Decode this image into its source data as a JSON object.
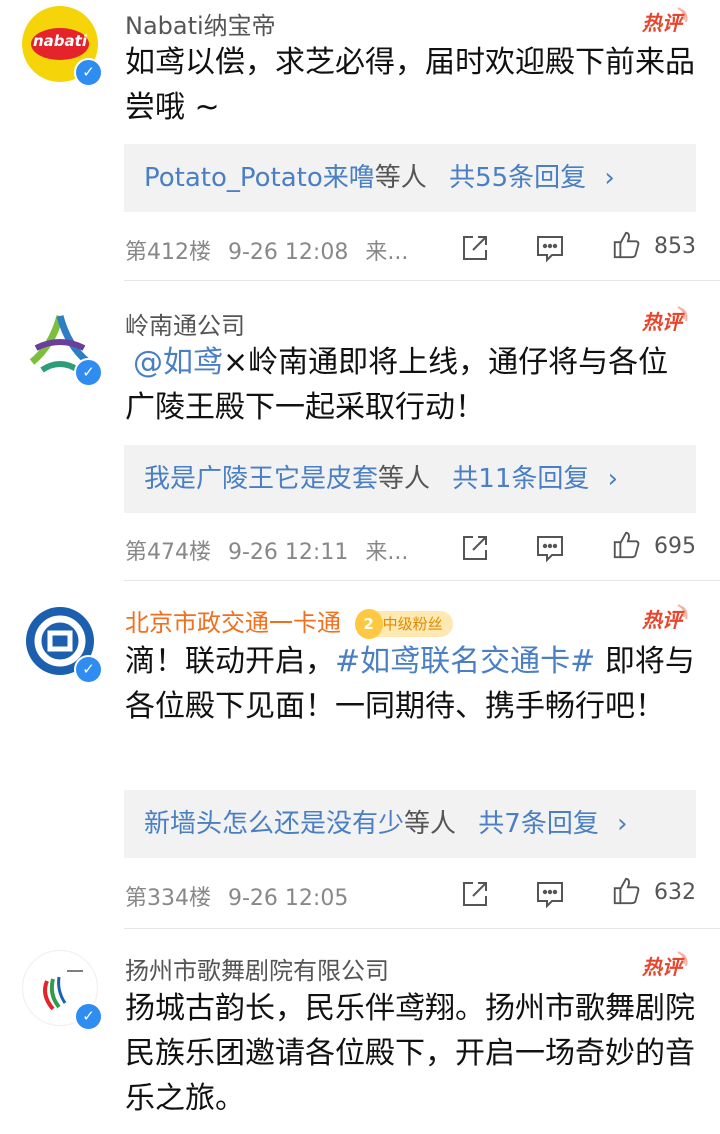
{
  "comments": [
    {
      "user": "Nabati纳宝帝",
      "avatar_text": "nabati",
      "text": "如鸢以偿，求芝必得，届时欢迎殿下前来品尝哦 ~",
      "reply_users": "Potato_Potato来噜",
      "reply_etc": "等人",
      "reply_count": "共55条回复",
      "floor": "第412楼",
      "time": "9-26 12:08",
      "source": "来...",
      "likes": "853"
    },
    {
      "user": "岭南通公司",
      "mention": "@如鸢",
      "text": "×岭南通即将上线，通仔将与各位广陵王殿下一起采取行动！",
      "reply_users": "我是广陵王它是皮套",
      "reply_etc": "等人",
      "reply_count": "共11条回复",
      "floor": "第474楼",
      "time": "9-26 12:11",
      "source": "来...",
      "likes": "695"
    },
    {
      "user": "北京市政交通一卡通",
      "fan_level": "2",
      "fan_badge": "中级粉丝",
      "text_before": "滴！联动开启，",
      "topic": "#如鸢联名交通卡#",
      "text_after": " 即将与各位殿下见面！一同期待、携手畅行吧！",
      "reply_users": "新墙头怎么还是没有少",
      "reply_etc": "等人",
      "reply_count": "共7条回复",
      "floor": "第334楼",
      "time": "9-26 12:05",
      "likes": "632"
    },
    {
      "user": "扬州市歌舞剧院有限公司",
      "text": "扬城古韵长，民乐伴鸢翔。扬州市歌舞剧院民族乐团邀请各位殿下，开启一场奇妙的音乐之旅。"
    }
  ],
  "hot_label": "热评",
  "verified_mark": "✓",
  "chevron": "›",
  "icons": [
    "share-icon",
    "comment-icon",
    "like-icon"
  ],
  "colors": {
    "link": "#4a7fc4",
    "hot": "#e8452c",
    "verified": "#2f8cf0",
    "orange_name": "#f26f1d"
  }
}
